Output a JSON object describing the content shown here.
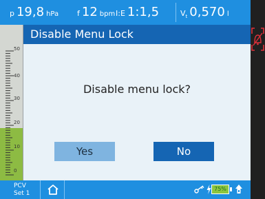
{
  "topbar": {
    "pressure": {
      "symbol": "p",
      "value": "19,8",
      "unit": "hPa"
    },
    "frequency": {
      "symbol": "f",
      "value": "12",
      "unit": "bpm"
    },
    "ie_ratio": {
      "symbol": "I:E",
      "value": "1:1,5"
    },
    "tidal_volume": {
      "symbol": "V",
      "subscript": "t",
      "value": "0,570",
      "unit": "l"
    }
  },
  "scale": {
    "labels": [
      "50",
      "40",
      "30",
      "20",
      "10",
      "0"
    ]
  },
  "dialog": {
    "title": "Disable Menu Lock",
    "message": "Disable menu lock?",
    "yes_label": "Yes",
    "no_label": "No"
  },
  "bottombar": {
    "mode_line1": "PCV",
    "mode_line2": "Set 1",
    "battery_percent": "75%"
  },
  "icons": {
    "alarm": "bell-crossed-icon",
    "home": "home-icon",
    "key": "key-icon",
    "power": "lightning-icon",
    "plug": "plug-icon"
  },
  "colors": {
    "header_blue": "#1f8fe0",
    "dialog_title_blue": "#1565b3",
    "yes_button": "#7fb4e0",
    "scale_green": "#8dbb43",
    "alarm_red": "#e0303a"
  }
}
